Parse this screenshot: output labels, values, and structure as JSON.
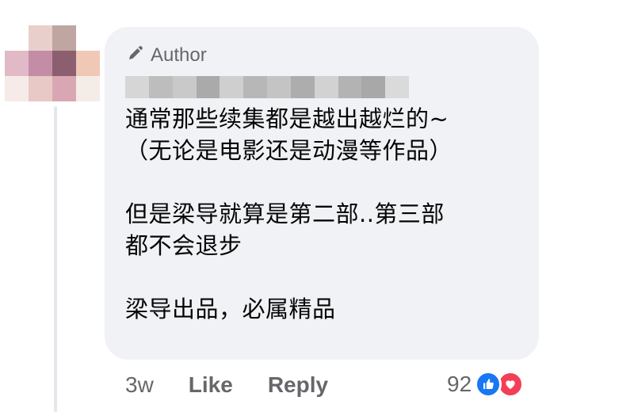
{
  "avatar": {
    "pixels": [
      "#ffffff",
      "#e9cfcc",
      "#bfa6a0",
      "#ffffff",
      "#e2b9c6",
      "#c48da7",
      "#8c5f70",
      "#f0c9b6",
      "#f6ebe8",
      "#e8c9c6",
      "#d9a7b4",
      "#f4ece6"
    ]
  },
  "comment": {
    "author_badge": "Author",
    "author_name_blurred": true,
    "text": "通常那些续集都是越出越烂的~\n（无论是电影还是动漫等作品）\n\n但是梁导就算是第二部..第三部\n都不会退步\n\n梁导出品，必属精品"
  },
  "actions": {
    "time": "3w",
    "like": "Like",
    "reply": "Reply"
  },
  "reactions": {
    "count": "92",
    "icons": [
      "like-icon",
      "love-icon"
    ],
    "colors": {
      "like": "#1877f2",
      "love": "#f33e58"
    }
  },
  "colors": {
    "bubble": "#f0f2f5",
    "secondary_text": "#65676b",
    "primary_text": "#050505"
  }
}
